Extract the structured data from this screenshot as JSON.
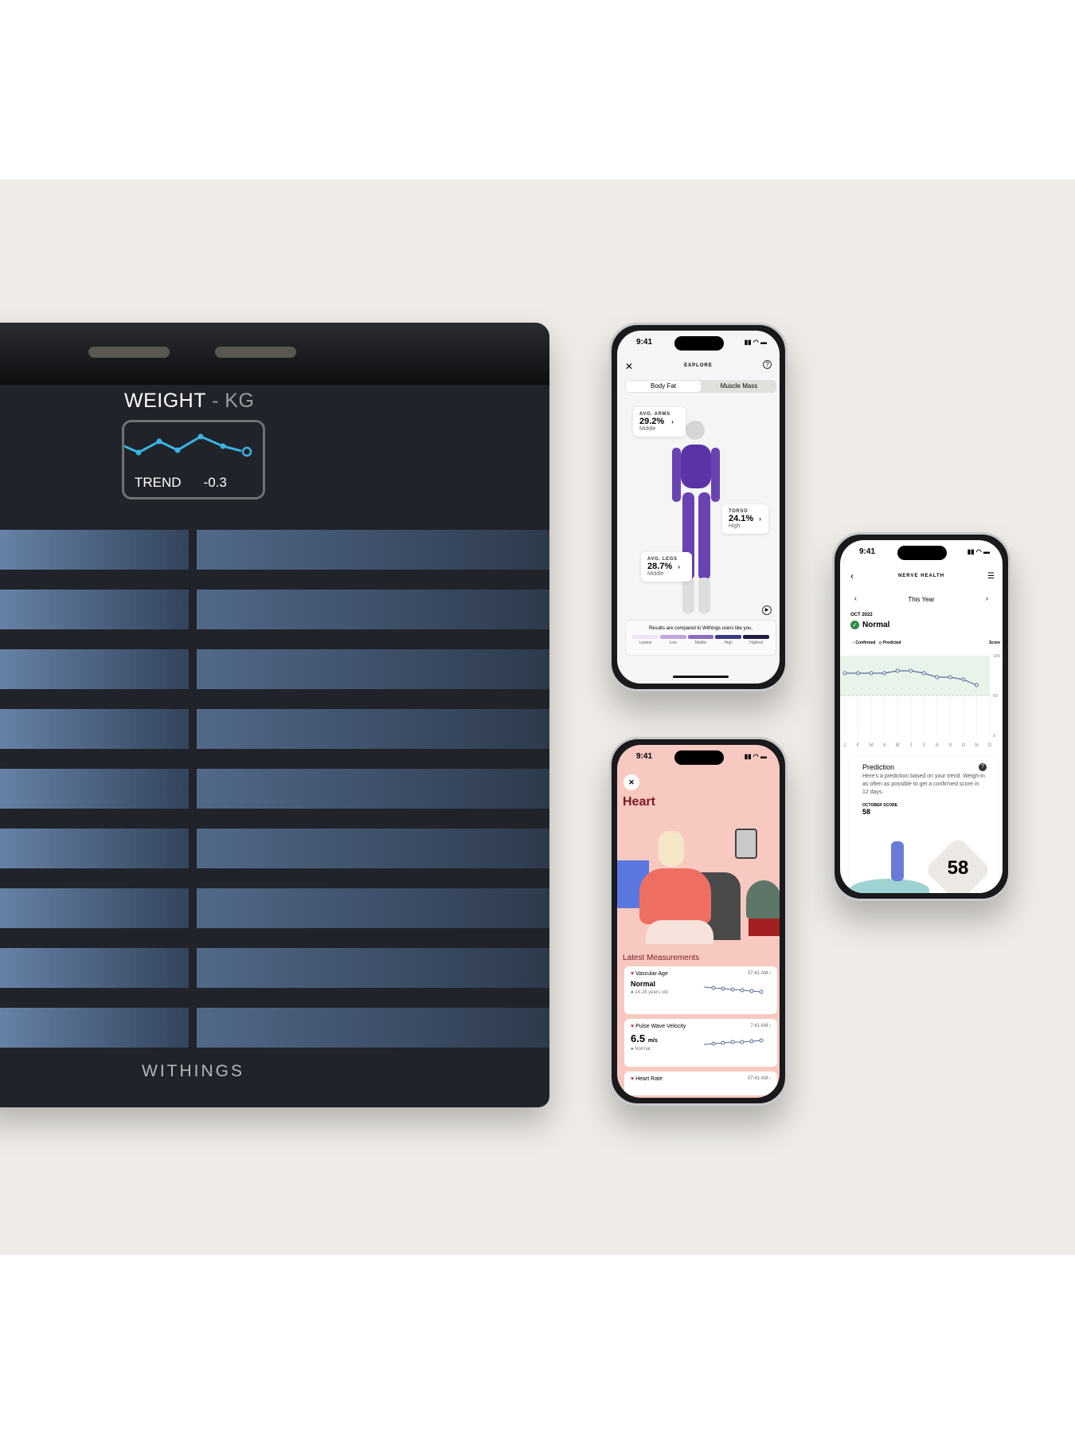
{
  "scale": {
    "display_title": "WEIGHT",
    "display_unit": "- KG",
    "trend_label": "TREND",
    "trend_value": "-0.3",
    "trend_color": "#3bb3e3",
    "brand": "WITHINGS"
  },
  "explore": {
    "time": "9:41",
    "title": "EXPLORE",
    "close_icon": "close-icon",
    "help_icon": "help-icon",
    "tabs": [
      {
        "label": "Body Fat",
        "active": true
      },
      {
        "label": "Muscle Mass",
        "active": false
      }
    ],
    "arms": {
      "label": "AVG. ARMS",
      "value": "29.2%",
      "level": "Middle"
    },
    "torso": {
      "label": "TORSO",
      "value": "24.1%",
      "level": "High"
    },
    "legs": {
      "label": "AVG. LEGS",
      "value": "28.7%",
      "level": "Middle"
    },
    "compare_text": "Results are compared to Withings users like you.",
    "legend": [
      "Lowest",
      "Low",
      "Middle",
      "High",
      "Highest"
    ],
    "legend_colors": [
      "#efe3f5",
      "#c3a6dc",
      "#8c6cc0",
      "#3d3a85",
      "#1e1b45"
    ],
    "body_color": "#5b33a6"
  },
  "nerve": {
    "time": "9:41",
    "title": "NERVE HEALTH",
    "period": "This Year",
    "date": "OCT 2022",
    "status": "Normal",
    "legend_confirmed": "Confirmed",
    "legend_predicted": "Predicted",
    "score_label": "Score",
    "chart_data": {
      "type": "line",
      "categories": [
        "J",
        "F",
        "M",
        "A",
        "M",
        "J",
        "J",
        "A",
        "S",
        "O",
        "N",
        "D"
      ],
      "values": [
        78,
        78,
        78,
        78,
        81,
        81,
        78,
        73,
        73,
        70,
        63,
        null
      ],
      "yticks": [
        "100",
        "50",
        "0"
      ],
      "ylim": [
        0,
        100
      ],
      "normal_band": [
        50,
        100
      ]
    },
    "prediction_title": "Prediction",
    "prediction_text": "Here's a prediction based on your trend. Weigh-in as often as possible to get a confirmed score in 12 days.",
    "october_label": "OCTOBER SCORE",
    "october_value": "58",
    "badge_value": "58"
  },
  "heart": {
    "time": "9:41",
    "title": "Heart",
    "section": "Latest Measurements",
    "items": [
      {
        "name": "Vascular Age",
        "time": "07:41 AM",
        "value": "Normal",
        "unit": "",
        "status": "24-28 years old"
      },
      {
        "name": "Pulse Wave Velocity",
        "time": "7:41 AM",
        "value": "6.5",
        "unit": "m/s",
        "status": "Normal"
      },
      {
        "name": "Heart Rate",
        "time": "07:41 AM",
        "value": "",
        "unit": "",
        "status": ""
      }
    ]
  }
}
